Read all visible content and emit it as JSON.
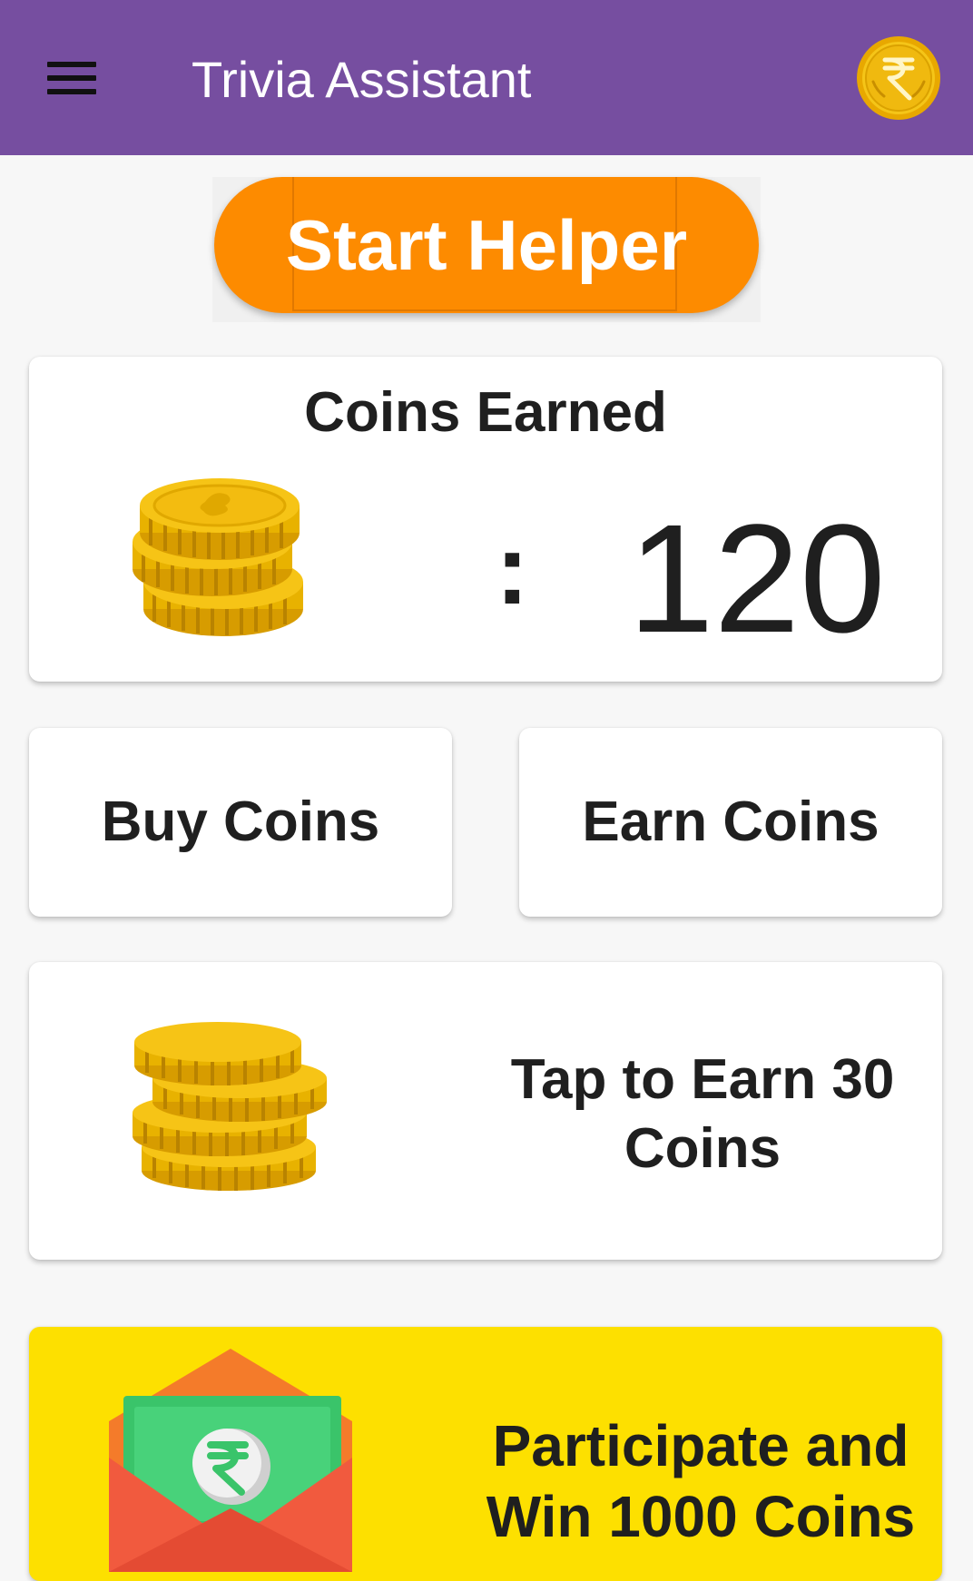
{
  "app_bar": {
    "title": "Trivia Assistant",
    "menu_icon": "hamburger-menu-icon",
    "action_icon": "rupee-coin-icon",
    "background_color": "#764ea0"
  },
  "start_button": {
    "label": "Start Helper",
    "color": "#fd8b00"
  },
  "coins_card": {
    "heading": "Coins Earned",
    "separator": ":",
    "value": "120",
    "icon": "coin-stack-icon"
  },
  "action_cards": {
    "buy_label": "Buy Coins",
    "earn_label": "Earn Coins"
  },
  "tap_card": {
    "label": "Tap to Earn 30 Coins",
    "icon": "coin-pile-icon"
  },
  "win_card": {
    "label": "Participate and Win 1000 Coins",
    "icon": "money-envelope-icon",
    "background_color": "#fde000"
  }
}
